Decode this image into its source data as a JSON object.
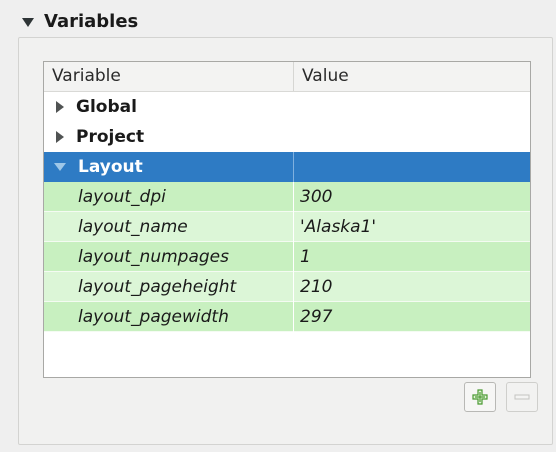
{
  "section": {
    "title": "Variables"
  },
  "tree": {
    "columns": {
      "variable": "Variable",
      "value": "Value"
    },
    "groups": [
      {
        "label": "Global",
        "expanded": false
      },
      {
        "label": "Project",
        "expanded": false
      },
      {
        "label": "Layout",
        "expanded": true,
        "selected": true
      }
    ],
    "variables": [
      {
        "name": "layout_dpi",
        "value": "300"
      },
      {
        "name": "layout_name",
        "value": "'Alaska1'"
      },
      {
        "name": "layout_numpages",
        "value": "1"
      },
      {
        "name": "layout_pageheight",
        "value": "210"
      },
      {
        "name": "layout_pagewidth",
        "value": "297"
      }
    ]
  },
  "buttons": {
    "add_icon": "plus-icon",
    "remove_icon": "minus-icon"
  },
  "colors": {
    "selection": "#2e7bc4",
    "variable_row_even": "#c8f0c0",
    "variable_row_odd": "#dcf6d7",
    "add_icon_green": "#4a9a32"
  }
}
